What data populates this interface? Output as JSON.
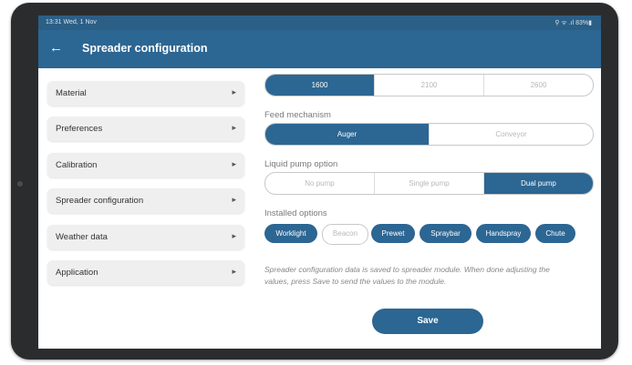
{
  "status_bar": {
    "time": "13:31  Wed, 1 Nov",
    "icons_text": "⚲ ᯤ .ıl 83%▮"
  },
  "app_bar": {
    "back_icon": "arrow-left-icon",
    "title": "Spreader configuration"
  },
  "sidebar": {
    "items": [
      {
        "label": "Material"
      },
      {
        "label": "Preferences"
      },
      {
        "label": "Calibration"
      },
      {
        "label": "Spreader configuration"
      },
      {
        "label": "Weather data"
      },
      {
        "label": "Application"
      }
    ],
    "chevron_glyph": "▸"
  },
  "content": {
    "top_cut_label": "",
    "size_options": {
      "options": [
        "1600",
        "2100",
        "2600"
      ],
      "selected": "1600"
    },
    "feed_mechanism": {
      "label": "Feed mechanism",
      "options": [
        "Auger",
        "Conveyor"
      ],
      "selected": "Auger"
    },
    "liquid_pump": {
      "label": "Liquid pump option",
      "options": [
        "No pump",
        "Single pump",
        "Dual pump"
      ],
      "selected": "Dual pump"
    },
    "installed_options": {
      "label": "Installed options",
      "chips": [
        {
          "label": "Worklight",
          "selected": true
        },
        {
          "label": "Beacon",
          "selected": false
        },
        {
          "label": "Prewet",
          "selected": true
        },
        {
          "label": "Spraybar",
          "selected": true
        },
        {
          "label": "Handspray",
          "selected": true
        },
        {
          "label": "Chute",
          "selected": true
        }
      ]
    },
    "info_text": "Spreader configuration data is saved to spreader module. When done adjusting the values, press Save to send the values to the module.",
    "save_label": "Save"
  },
  "colors": {
    "primary": "#2c6693",
    "status_bar": "#2c5f86",
    "tablet_frame": "#2b2c2e"
  }
}
